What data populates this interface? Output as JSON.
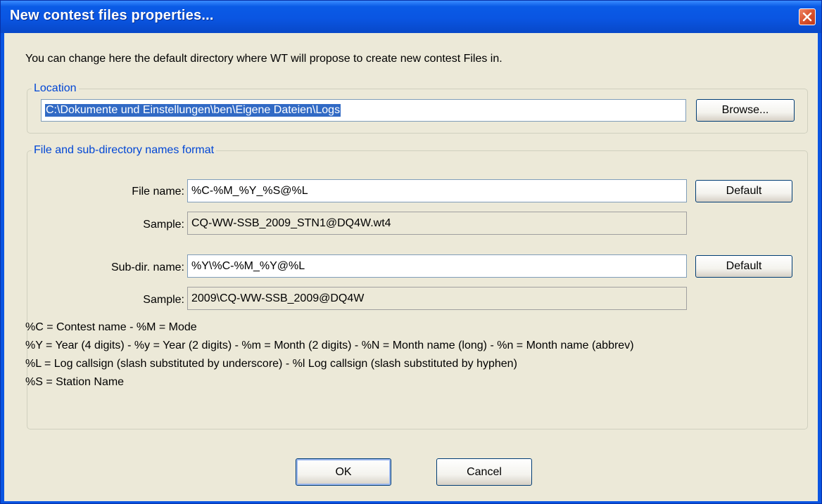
{
  "window": {
    "title": "New contest files properties...",
    "close_glyph": "✕",
    "colors": {
      "titlebar": "#0a55e2",
      "client": "#ece9d8",
      "group_label": "#0046d5",
      "selection": "#316ac5",
      "close_button": "#d8532e"
    }
  },
  "intro": "You can change here the default directory where WT will propose to create new contest Files in.",
  "location": {
    "legend": "Location",
    "path_value": "C:\\Dokumente und Einstellungen\\ben\\Eigene Dateien\\Logs",
    "browse_label": "Browse..."
  },
  "format": {
    "legend": "File and sub-directory names format",
    "file_name_label": "File name:",
    "file_name_value": "%C-%M_%Y_%S@%L",
    "file_default_label": "Default",
    "file_sample_label": "Sample:",
    "file_sample_value": "CQ-WW-SSB_2009_STN1@DQ4W.wt4",
    "subdir_label": "Sub-dir. name:",
    "subdir_value": "%Y\\%C-%M_%Y@%L",
    "subdir_default_label": "Default",
    "subdir_sample_label": "Sample:",
    "subdir_sample_value": "2009\\CQ-WW-SSB_2009@DQ4W",
    "help_lines": [
      "%C = Contest name - %M = Mode",
      "%Y = Year (4 digits) - %y = Year (2 digits) - %m = Month (2 digits) - %N = Month name (long) - %n = Month name (abbrev)",
      "%L = Log callsign (slash substituted by underscore) - %l Log callsign (slash substituted by hyphen)",
      "%S = Station Name"
    ]
  },
  "buttons": {
    "ok_label": "OK",
    "cancel_label": "Cancel"
  }
}
